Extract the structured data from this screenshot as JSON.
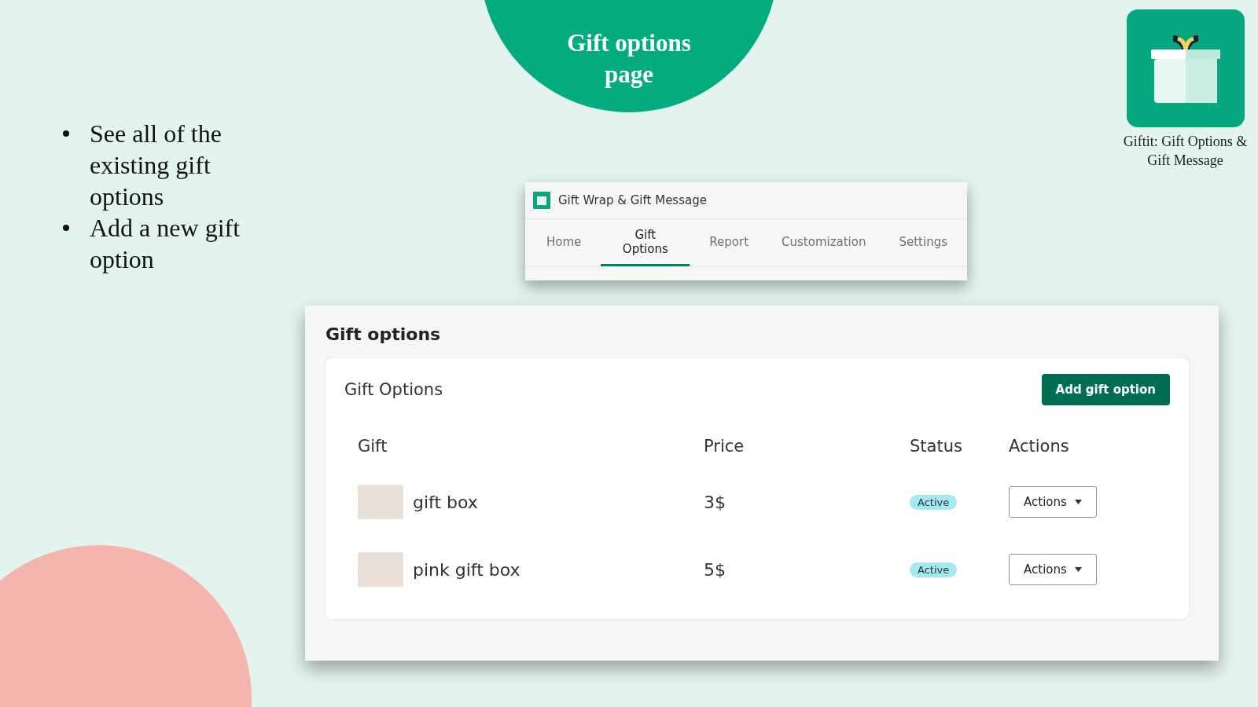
{
  "banner": {
    "title": "Gift options page"
  },
  "bullets": [
    "See all of the existing gift options",
    "Add a new gift option"
  ],
  "app_logo": {
    "caption": "Giftit: Gift Options & Gift Message"
  },
  "app_window": {
    "title": "Gift Wrap & Gift Message",
    "tabs": [
      {
        "label": "Home",
        "selected": false
      },
      {
        "label": "Gift Options",
        "selected": true
      },
      {
        "label": "Report",
        "selected": false
      },
      {
        "label": "Customization",
        "selected": false
      },
      {
        "label": "Settings",
        "selected": false
      }
    ]
  },
  "page": {
    "title": "Gift options",
    "card_title": "Gift Options",
    "add_button": "Add gift option",
    "table": {
      "columns": [
        "Gift",
        "Price",
        "Status",
        "Actions"
      ],
      "rows": [
        {
          "gift": "gift box",
          "price": "3$",
          "status": "Active",
          "action": "Actions"
        },
        {
          "gift": "pink gift box",
          "price": "5$",
          "status": "Active",
          "action": "Actions"
        }
      ]
    }
  }
}
